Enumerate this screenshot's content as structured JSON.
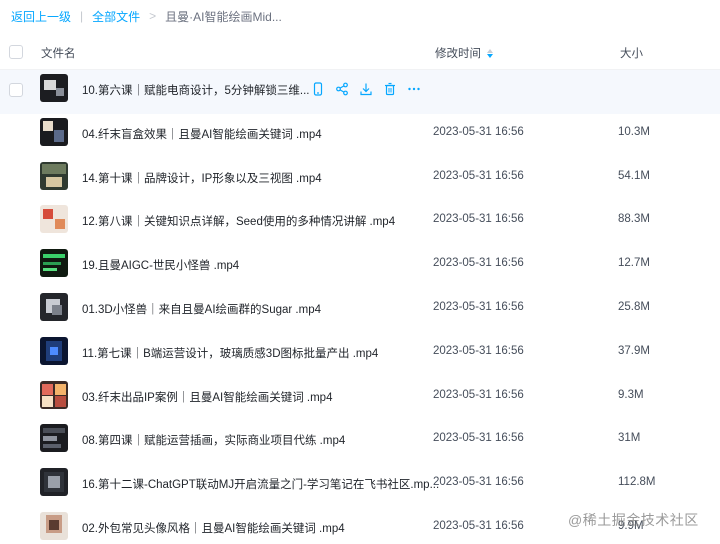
{
  "breadcrumb": {
    "back": "返回上一级",
    "all_files": "全部文件",
    "current": "且曼·AI智能绘画Mid..."
  },
  "columns": {
    "name": "文件名",
    "modified": "修改时间",
    "size": "大小"
  },
  "colors": {
    "accent": "#06a7ff",
    "hover_row": "#f5f8fd"
  },
  "files": [
    {
      "name": "10.第六课｜赋能电商设计，5分钟解锁三维...",
      "time": "",
      "size": "",
      "hovered": true
    },
    {
      "name": "04.纤末盲盒效果｜且曼AI智能绘画关键词 .mp4",
      "time": "2023-05-31 16:56",
      "size": "10.3M"
    },
    {
      "name": "14.第十课｜品牌设计，IP形象以及三视图 .mp4",
      "time": "2023-05-31 16:56",
      "size": "54.1M"
    },
    {
      "name": "12.第八课｜关键知识点详解，Seed使用的多种情况讲解 .mp4",
      "time": "2023-05-31 16:56",
      "size": "88.3M"
    },
    {
      "name": "19.且曼AIGC-世民小怪兽 .mp4",
      "time": "2023-05-31 16:56",
      "size": "12.7M"
    },
    {
      "name": "01.3D小怪兽｜来自且曼AI绘画群的Sugar .mp4",
      "time": "2023-05-31 16:56",
      "size": "25.8M"
    },
    {
      "name": "11.第七课｜B端运营设计，玻璃质感3D图标批量产出 .mp4",
      "time": "2023-05-31 16:56",
      "size": "37.9M"
    },
    {
      "name": "03.纤末出品IP案例｜且曼AI智能绘画关键词 .mp4",
      "time": "2023-05-31 16:56",
      "size": "9.3M"
    },
    {
      "name": "08.第四课｜赋能运营插画，实际商业项目代练 .mp4",
      "time": "2023-05-31 16:56",
      "size": "31M"
    },
    {
      "name": "16.第十二课-ChatGPT联动MJ开启流量之门-学习笔记在飞书社区.mp...",
      "time": "2023-05-31 16:56",
      "size": "112.8M"
    },
    {
      "name": "02.外包常见头像风格｜且曼AI智能绘画关键词 .mp4",
      "time": "2023-05-31 16:56",
      "size": "9.9M"
    }
  ],
  "row_action_icons": [
    "phone-icon",
    "share-icon",
    "download-icon",
    "delete-icon",
    "more-icon"
  ],
  "watermark": "@稀土掘金技术社区"
}
